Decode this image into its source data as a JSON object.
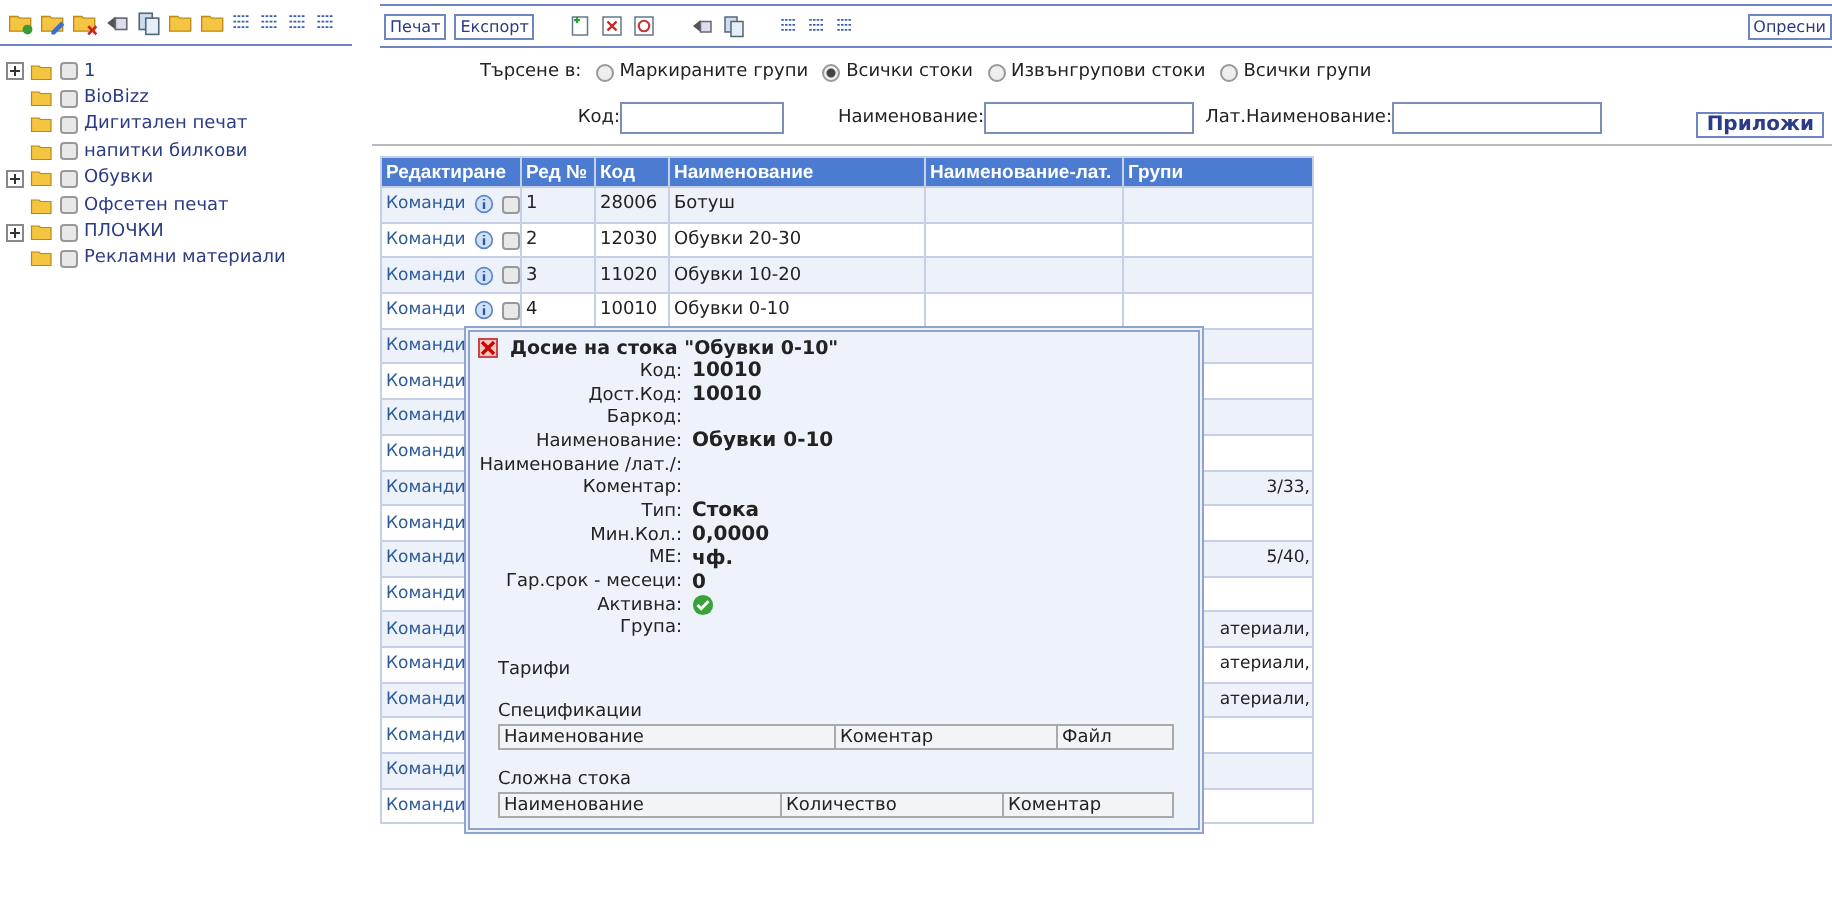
{
  "tree": [
    {
      "label": "1",
      "kind": "branch",
      "checked": false
    },
    {
      "label": "BioBizz",
      "kind": "leaf",
      "checked": false
    },
    {
      "label": "Дигитален печат",
      "kind": "leaf",
      "checked": false
    },
    {
      "label": "напитки билкови",
      "kind": "leaf",
      "checked": false
    },
    {
      "label": "Обувки",
      "kind": "branch",
      "checked": false
    },
    {
      "label": "Офсетен печат",
      "kind": "leaf",
      "checked": false
    },
    {
      "label": "ПЛОЧКИ",
      "kind": "branch",
      "checked": false
    },
    {
      "label": "Рекламни материали",
      "kind": "leaf",
      "checked": false
    }
  ],
  "toolbar": {
    "buttons": [
      "Печат",
      "Експорт"
    ],
    "refresh_button": "Опресни"
  },
  "search": {
    "label": "Търсене в:",
    "options": [
      {
        "label": "Маркираните групи",
        "selected": false
      },
      {
        "label": "Всички стоки",
        "selected": true
      },
      {
        "label": "Извънгрупови стоки",
        "selected": false
      },
      {
        "label": "Всички групи",
        "selected": false
      }
    ],
    "fields": [
      {
        "label": "Код:"
      },
      {
        "label": "Наименование:"
      },
      {
        "label": "Лат.Наименование:"
      }
    ],
    "apply_button": "Приложи"
  },
  "table": {
    "columns": [
      "Редактиране",
      "Ред №",
      "Код",
      "Наименование",
      "Наименование-лат.",
      "Групи"
    ],
    "rows": [
      {
        "kind": "full",
        "command": "Команди",
        "checked": false,
        "row_no": "1",
        "code": "28006",
        "name": "Ботуш"
      },
      {
        "kind": "full",
        "command": "Команди",
        "checked": false,
        "row_no": "2",
        "code": "12030",
        "name": "Обувки 20-30"
      },
      {
        "kind": "full",
        "command": "Команди",
        "checked": false,
        "row_no": "3",
        "code": "11020",
        "name": "Обувки 10-20"
      },
      {
        "kind": "full",
        "command": "Команди",
        "checked": false,
        "row_no": "4",
        "code": "10010",
        "name": "Обувки 0-10"
      },
      {
        "kind": "covered",
        "command": "Команди"
      },
      {
        "kind": "covered",
        "command": "Команди"
      },
      {
        "kind": "covered",
        "command": "Команди"
      },
      {
        "kind": "covered",
        "command": "Команди"
      },
      {
        "kind": "covered",
        "command": "Команди",
        "groups": "3/33,"
      },
      {
        "kind": "covered",
        "command": "Команди"
      },
      {
        "kind": "covered",
        "command": "Команди",
        "groups": "5/40,"
      },
      {
        "kind": "covered",
        "command": "Команди"
      },
      {
        "kind": "covered",
        "command": "Команди",
        "groups": "атериали,"
      },
      {
        "kind": "covered",
        "command": "Команди",
        "groups": "атериали,"
      },
      {
        "kind": "covered",
        "command": "Команди",
        "groups": "атериали,"
      },
      {
        "kind": "covered",
        "command": "Команди"
      },
      {
        "kind": "covered",
        "command": "Команди"
      },
      {
        "kind": "covered",
        "command": "Команди"
      }
    ]
  },
  "dialog": {
    "title": "Досие на стока \"Обувки 0-10\"",
    "fields": [
      {
        "label": "Код:",
        "kind": "text",
        "value": "10010"
      },
      {
        "label": "Дост.Код:",
        "kind": "text",
        "value": "10010"
      },
      {
        "label": "Баркод:",
        "kind": "text"
      },
      {
        "label": "Наименование:",
        "kind": "text",
        "value": "Обувки 0-10"
      },
      {
        "label": "Наименование /лат./:",
        "kind": "text"
      },
      {
        "label": "Коментар:",
        "kind": "text"
      },
      {
        "label": "Тип:",
        "kind": "text",
        "value": "Стока"
      },
      {
        "label": "Мин.Кол.:",
        "kind": "text",
        "value": "0,0000"
      },
      {
        "label": "МЕ:",
        "kind": "text",
        "value": "чф."
      },
      {
        "label": "Гар.срок - месеци:",
        "kind": "text",
        "value": "0"
      },
      {
        "label": "Активна:",
        "kind": "check",
        "checked": true
      },
      {
        "label": "Група:",
        "kind": "text"
      }
    ],
    "sections": [
      {
        "title": "Тарифи"
      },
      {
        "title": "Спецификации",
        "columns": [
          "Наименование",
          "Коментар",
          "Файл"
        ]
      },
      {
        "title": "Сложна стока",
        "columns": [
          "Наименование",
          "Количество",
          "Коментар"
        ]
      }
    ]
  }
}
